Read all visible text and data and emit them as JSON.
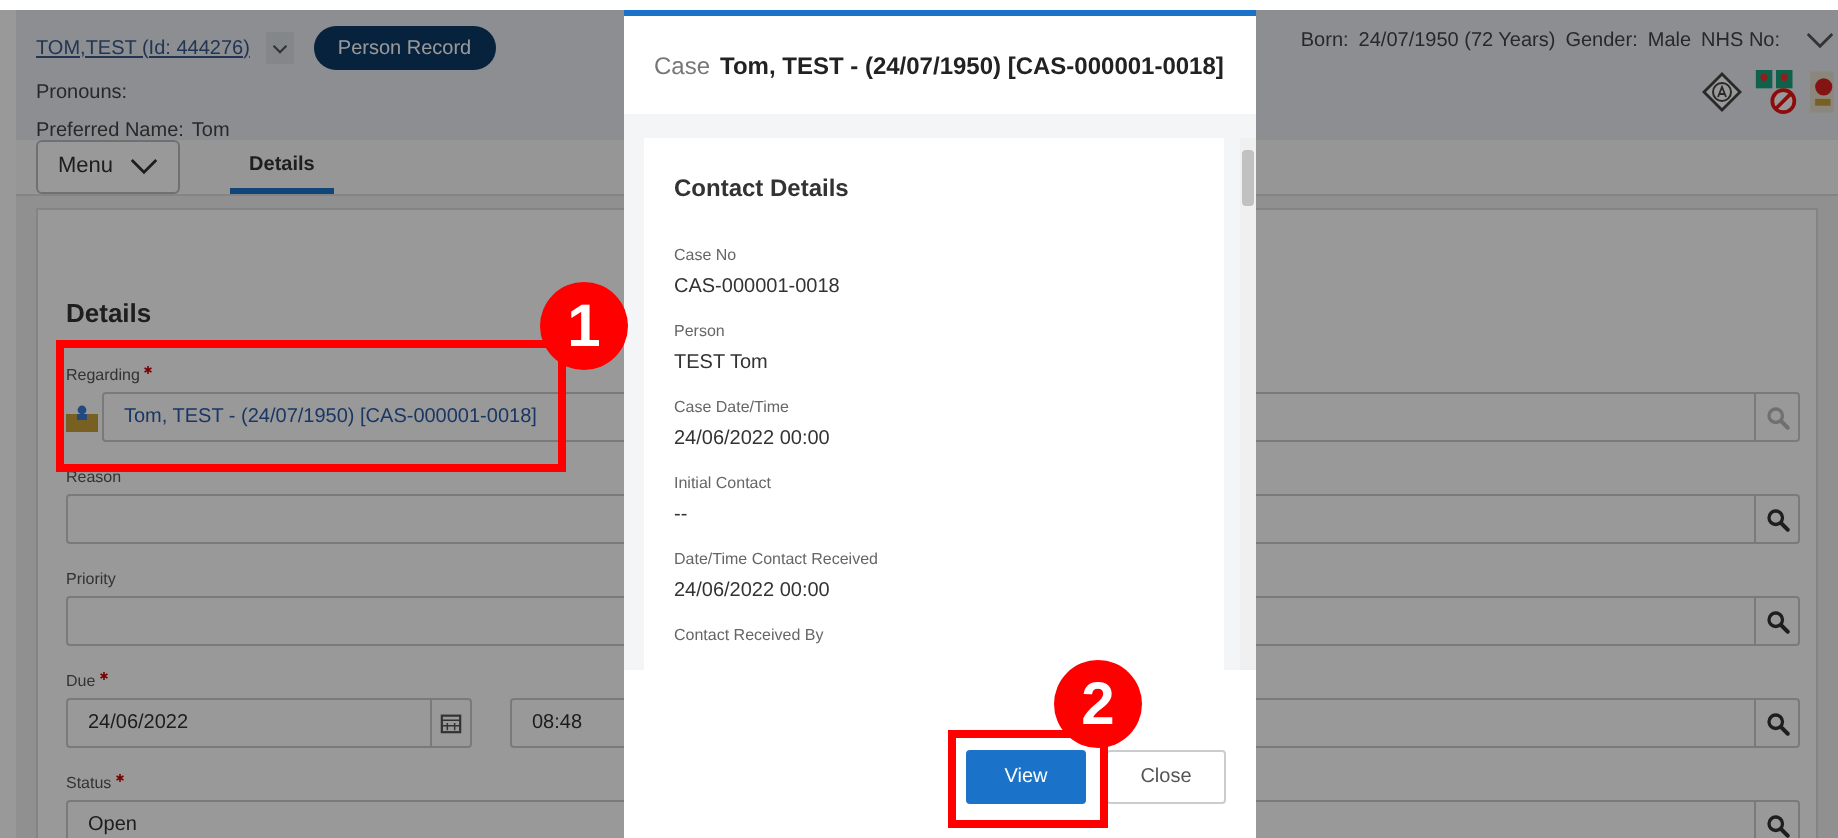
{
  "header": {
    "person_link": "TOM,TEST (Id: 444276)",
    "person_record_button": "Person Record",
    "pronouns_label": "Pronouns:",
    "preferred_name_label": "Preferred Name:",
    "preferred_name": "Tom",
    "born_label": "Born:",
    "born": "24/07/1950 (72 Years)",
    "gender_label": "Gender:",
    "gender": "Male",
    "nhs_label": "NHS No:"
  },
  "menu_button": "Menu",
  "tabs": [
    {
      "label": "Details",
      "selected": true
    }
  ],
  "form": {
    "title": "Details",
    "fields": [
      {
        "kind": "lookup",
        "label": "Regarding",
        "required": true,
        "value": "Tom, TEST - (24/07/1950) [CAS-000001-0018]",
        "search_disabled": true
      },
      {
        "kind": "lookup",
        "label": "Reason",
        "required": false,
        "search_disabled": false
      },
      {
        "kind": "lookup",
        "label": "Priority",
        "required": false,
        "search_disabled": false
      },
      {
        "kind": "datetime",
        "label": "Due",
        "required": true,
        "date": "24/06/2022",
        "time": "08:48",
        "search_disabled": false
      },
      {
        "kind": "lookup",
        "label": "Status",
        "required": true,
        "value": "Open",
        "search_disabled": false
      }
    ]
  },
  "dialog": {
    "title_prefix": "Case",
    "title": "Tom, TEST - (24/07/1950) [CAS-000001-0018]",
    "section_title": "Contact Details",
    "items": [
      {
        "label": "Case No",
        "value": "CAS-000001-0018"
      },
      {
        "label": "Person",
        "value": "TEST Tom"
      },
      {
        "label": "Case Date/Time",
        "value": "24/06/2022 00:00"
      },
      {
        "label": "Initial Contact",
        "value": "--"
      },
      {
        "label": "Date/Time Contact Received",
        "value": "24/06/2022 00:00"
      },
      {
        "label": "Contact Received By"
      }
    ],
    "buttons": [
      {
        "label": "View",
        "primary": true
      },
      {
        "label": "Close",
        "primary": false
      }
    ]
  },
  "annotations": [
    {
      "label": "1"
    },
    {
      "label": "2"
    }
  ]
}
